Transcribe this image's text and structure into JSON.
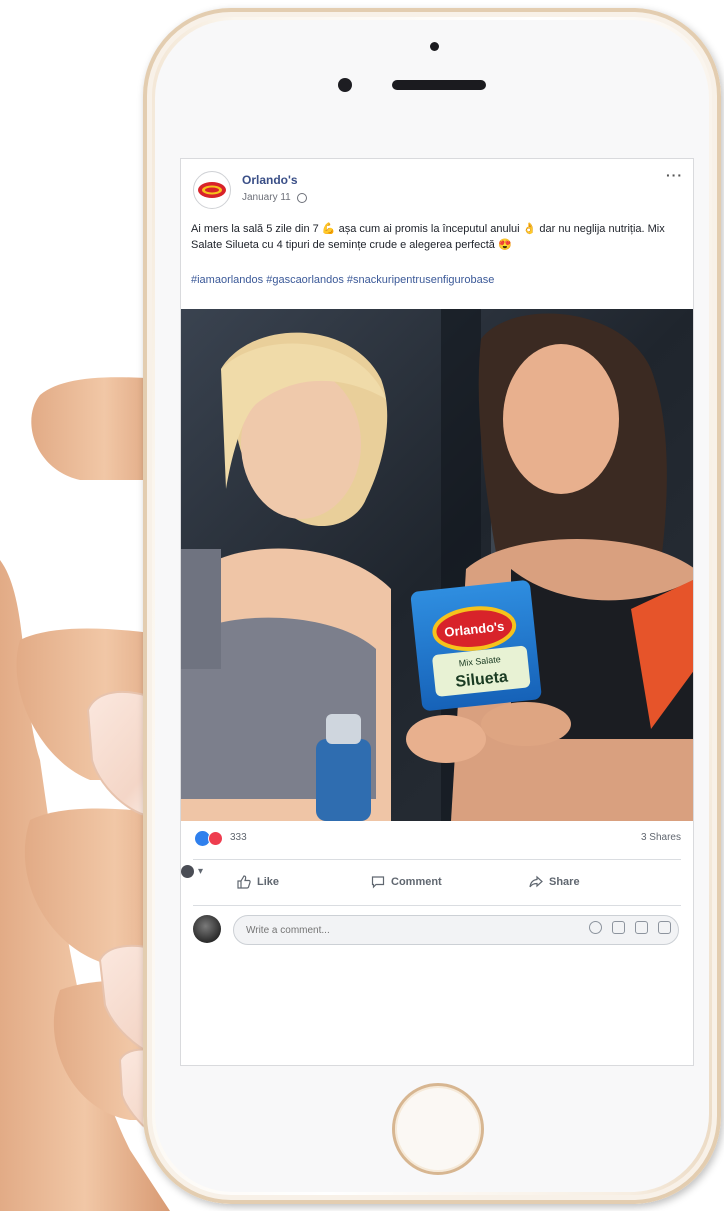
{
  "post": {
    "page_name": "Orlando's",
    "date": "January 11",
    "more": "···",
    "text": "Ai mers la sală 5 zile din 7 💪 așa cum ai promis la începutul anului 👌 dar nu neglija nutriția. Mix Salate Silueta cu 4 tipuri de semințe crude e alegerea perfectă 😍",
    "hashtags": "#iamaorlandos #gascaorlandos #snackuripentrusenfigurobase"
  },
  "product": {
    "brand": "Orlando's",
    "line1": "Mix Salate",
    "line2": "Silueta"
  },
  "stats": {
    "reaction_count": "333",
    "shares": "3 Shares"
  },
  "actions": {
    "like": "Like",
    "comment": "Comment",
    "share": "Share"
  },
  "comment_box": {
    "placeholder": "Write a comment..."
  },
  "colors": {
    "link": "#3b5998",
    "like_blue": "#2f80ed",
    "love_red": "#ee3d4f",
    "phone_gold": "#d7b691"
  }
}
